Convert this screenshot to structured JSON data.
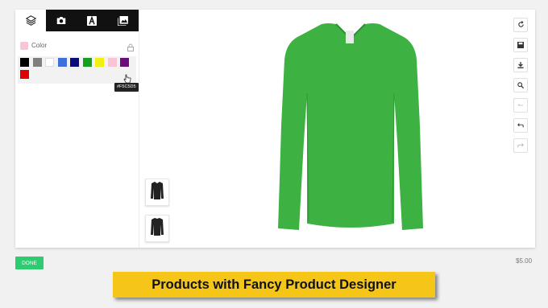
{
  "tabs": [
    {
      "icon": "layers-icon",
      "active": true
    },
    {
      "icon": "camera-icon",
      "active": false
    },
    {
      "icon": "text-icon",
      "active": false
    },
    {
      "icon": "images-icon",
      "active": false
    }
  ],
  "color_panel": {
    "label": "Color",
    "selected_color": "#f7c5d5",
    "tooltip": "#F5C5D5",
    "swatches": [
      "#000000",
      "#7f7f7f",
      "#ffffff",
      "#3f6fd8",
      "#0b0d7a",
      "#14a01e",
      "#f2ef12",
      "#f7c5d5",
      "#6a0d7a",
      "#e00000"
    ]
  },
  "toolbar": [
    "rotate-icon",
    "save-icon",
    "download-icon",
    "zoom-icon",
    "reset-icon",
    "undo-icon",
    "redo-icon"
  ],
  "product": {
    "shirt_color": "#3db243"
  },
  "footer": {
    "done_label": "DONE",
    "price": "$5.00"
  },
  "banner": {
    "text": "Products with Fancy Product Designer"
  }
}
